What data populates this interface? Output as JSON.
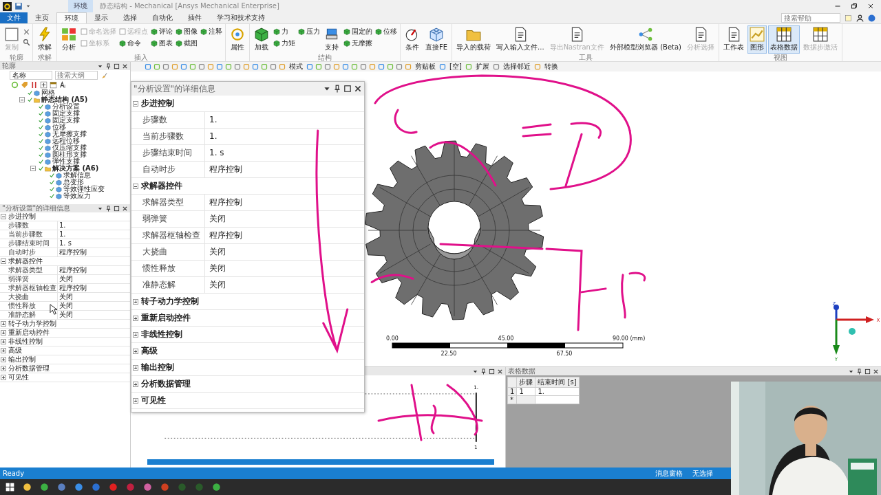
{
  "title_bar": {
    "context_tab": "环境",
    "title": "静态结构 - Mechanical [Ansys Mechanical Enterprise]"
  },
  "menu_tabs": [
    {
      "label": "文件",
      "kind": "file",
      "selected": false
    },
    {
      "label": "主页",
      "kind": "tab",
      "selected": false
    },
    {
      "label": "环境",
      "kind": "tab",
      "selected": true
    },
    {
      "label": "显示",
      "kind": "tab",
      "selected": false
    },
    {
      "label": "选择",
      "kind": "tab",
      "selected": false
    },
    {
      "label": "自动化",
      "kind": "tab",
      "selected": false
    },
    {
      "label": "插件",
      "kind": "tab",
      "selected": false
    },
    {
      "label": "学习和技术支持",
      "kind": "tab",
      "selected": false
    }
  ],
  "help_search": {
    "placeholder": "搜索帮助"
  },
  "ribbon": [
    {
      "label": "轮廓",
      "items": [
        {
          "kind": "large",
          "label": "复制",
          "disabled": true
        },
        {
          "kind": "tools"
        }
      ]
    },
    {
      "label": "求解",
      "items": [
        {
          "kind": "large",
          "label": "求解",
          "disabled": false
        }
      ]
    },
    {
      "label": "插入",
      "items": [
        {
          "kind": "large",
          "label": "分析",
          "disabled": false
        },
        {
          "kind": "column",
          "entries": [
            {
              "label": "命名选择",
              "disabled": true
            },
            {
              "label": "坐标系",
              "disabled": true
            }
          ]
        },
        {
          "kind": "column",
          "entries": [
            {
              "label": "远程点",
              "disabled": true
            },
            {
              "label": "命令",
              "disabled": false
            }
          ]
        },
        {
          "kind": "column",
          "entries": [
            {
              "label": "评论",
              "disabled": false
            },
            {
              "label": "图表",
              "disabled": false
            }
          ]
        },
        {
          "kind": "column",
          "entries": [
            {
              "label": "图像",
              "disabled": false
            },
            {
              "label": "截图",
              "disabled": false
            }
          ]
        },
        {
          "kind": "column",
          "entries": [
            {
              "label": "注释",
              "disabled": false
            }
          ]
        }
      ]
    },
    {
      "items": [
        {
          "kind": "large",
          "label": "属性",
          "disabled": false
        }
      ]
    },
    {
      "label": "结构",
      "items": [
        {
          "kind": "large",
          "label": "加载",
          "disabled": false
        },
        {
          "kind": "column",
          "entries": [
            {
              "label": "力",
              "disabled": false
            },
            {
              "label": "力矩",
              "disabled": false
            }
          ]
        },
        {
          "kind": "column",
          "entries": [
            {
              "label": "压力",
              "disabled": false
            }
          ]
        },
        {
          "kind": "large",
          "label": "支持",
          "disabled": false
        },
        {
          "kind": "column",
          "entries": [
            {
              "label": "固定的",
              "disabled": false
            },
            {
              "label": "无摩擦",
              "disabled": false
            }
          ]
        },
        {
          "kind": "column",
          "entries": [
            {
              "label": "位移",
              "disabled": false
            }
          ]
        }
      ]
    },
    {
      "items": [
        {
          "kind": "large",
          "label": "条件",
          "disabled": false
        },
        {
          "kind": "large",
          "label": "直接FE",
          "disabled": false
        }
      ]
    },
    {
      "label": "工具",
      "items": [
        {
          "kind": "large",
          "label": "导入的载荷",
          "disabled": false
        },
        {
          "kind": "large",
          "label": "写入输入文件...",
          "disabled": false
        },
        {
          "kind": "large",
          "label": "导出Nastran文件",
          "disabled": true
        },
        {
          "kind": "large",
          "label": "外部模型浏览器 (Beta)",
          "disabled": false
        },
        {
          "kind": "large",
          "label": "分析选择",
          "disabled": true
        }
      ]
    },
    {
      "label": "视图",
      "items": [
        {
          "kind": "large",
          "label": "工作表",
          "disabled": false,
          "on": false
        },
        {
          "kind": "large",
          "label": "图形",
          "disabled": false,
          "on": true
        },
        {
          "kind": "large",
          "label": "表格数据",
          "disabled": false,
          "on": true
        },
        {
          "kind": "large",
          "label": "数据步激活",
          "disabled": true,
          "on": false
        }
      ]
    }
  ],
  "outline": {
    "title": "轮廓",
    "filter": "名称",
    "search": {
      "placeholder": "搜索大纲"
    },
    "tree": [
      {
        "label": "网格",
        "bold": false
      },
      {
        "label": "静态结构 (A5)",
        "bold": true,
        "expanded": true,
        "children": [
          {
            "label": "分析设置",
            "bold": false
          },
          {
            "label": "固定支撑",
            "bold": false
          },
          {
            "label": "固定支撑",
            "bold": false
          },
          {
            "label": "位移",
            "bold": false
          },
          {
            "label": "无摩擦支撑",
            "bold": false
          },
          {
            "label": "远程位移",
            "bold": false
          },
          {
            "label": "仅压缩支撑",
            "bold": false
          },
          {
            "label": "圆柱形支撑",
            "bold": false
          },
          {
            "label": "弹性支撑",
            "bold": false
          },
          {
            "label": "解决方案 (A6)",
            "bold": true,
            "expanded": true,
            "children": [
              {
                "label": "求解信息",
                "bold": false
              },
              {
                "label": "总变形",
                "bold": false
              },
              {
                "label": "等效弹性应变",
                "bold": false
              },
              {
                "label": "等效应力",
                "bold": false
              }
            ]
          }
        ]
      }
    ]
  },
  "details_docked": {
    "title": "\"分析设置\"的详细信息",
    "sections": [
      {
        "title": "步进控制",
        "expanded": true,
        "rows": [
          {
            "label": "步骤数",
            "value": "1."
          },
          {
            "label": "当前步骤数",
            "value": "1."
          },
          {
            "label": "步骤结束时间",
            "value": "1. s"
          },
          {
            "label": "自动时步",
            "value": "程序控制"
          }
        ]
      },
      {
        "title": "求解器控件",
        "expanded": true,
        "rows": [
          {
            "label": "求解器类型",
            "value": "程序控制"
          },
          {
            "label": "弱弹簧",
            "value": "关闭"
          },
          {
            "label": "求解器枢轴检查",
            "value": "程序控制"
          },
          {
            "label": "大挠曲",
            "value": "关闭"
          },
          {
            "label": "惯性释放",
            "value": "关闭"
          },
          {
            "label": "准静态解",
            "value": "关闭"
          }
        ]
      },
      {
        "title": "转子动力学控制",
        "expanded": false
      },
      {
        "title": "重新启动控件",
        "expanded": false
      },
      {
        "title": "非线性控制",
        "expanded": false
      },
      {
        "title": "高级",
        "expanded": false
      },
      {
        "title": "输出控制",
        "expanded": false
      },
      {
        "title": "分析数据管理",
        "expanded": false
      },
      {
        "title": "可见性",
        "expanded": false
      }
    ]
  },
  "details_floating": {
    "title": "\"分析设置\"的详细信息",
    "sections": [
      {
        "title": "步进控制",
        "expanded": true,
        "rows": [
          {
            "label": "步骤数",
            "value": "1."
          },
          {
            "label": "当前步骤数",
            "value": "1."
          },
          {
            "label": "步骤结束时间",
            "value": "1. s"
          },
          {
            "label": "自动时步",
            "value": "程序控制"
          }
        ]
      },
      {
        "title": "求解器控件",
        "expanded": true,
        "rows": [
          {
            "label": "求解器类型",
            "value": "程序控制"
          },
          {
            "label": "弱弹簧",
            "value": "关闭"
          },
          {
            "label": "求解器枢轴检查",
            "value": "程序控制"
          },
          {
            "label": "大挠曲",
            "value": "关闭"
          },
          {
            "label": "惯性释放",
            "value": "关闭"
          },
          {
            "label": "准静态解",
            "value": "关闭"
          }
        ]
      },
      {
        "title": "转子动力学控制",
        "expanded": false
      },
      {
        "title": "重新启动控件",
        "expanded": false
      },
      {
        "title": "非线性控制",
        "expanded": false
      },
      {
        "title": "高级",
        "expanded": false
      },
      {
        "title": "输出控制",
        "expanded": false
      },
      {
        "title": "分析数据管理",
        "expanded": false
      },
      {
        "title": "可见性",
        "expanded": false
      }
    ]
  },
  "graphics": {
    "toolbar": [
      {
        "label": "模式"
      },
      {
        "label": "剪贴板"
      },
      {
        "label": "[空]"
      },
      {
        "label": "扩展"
      },
      {
        "label": "选择邻近"
      },
      {
        "label": "转换"
      }
    ],
    "scale": {
      "top_labels": [
        "0.00",
        "45.00",
        "90.00 (mm)"
      ],
      "bottom_labels": [
        "22.50",
        "67.50"
      ]
    },
    "triad": {
      "z": "Z",
      "x": "X",
      "y": "Y"
    }
  },
  "graph_panel": {
    "top_label": "1.",
    "bottom_label": "1"
  },
  "tabular_data": {
    "title": "表格数据",
    "columns": [
      "步骤",
      "结束时间 [s]"
    ],
    "rows": [
      {
        "index": "1",
        "cells": [
          "1",
          "1."
        ]
      }
    ],
    "new_row_marker": "*"
  },
  "status_bar": {
    "message": "Ready",
    "items": [
      "消息窗格",
      "无选择"
    ]
  }
}
